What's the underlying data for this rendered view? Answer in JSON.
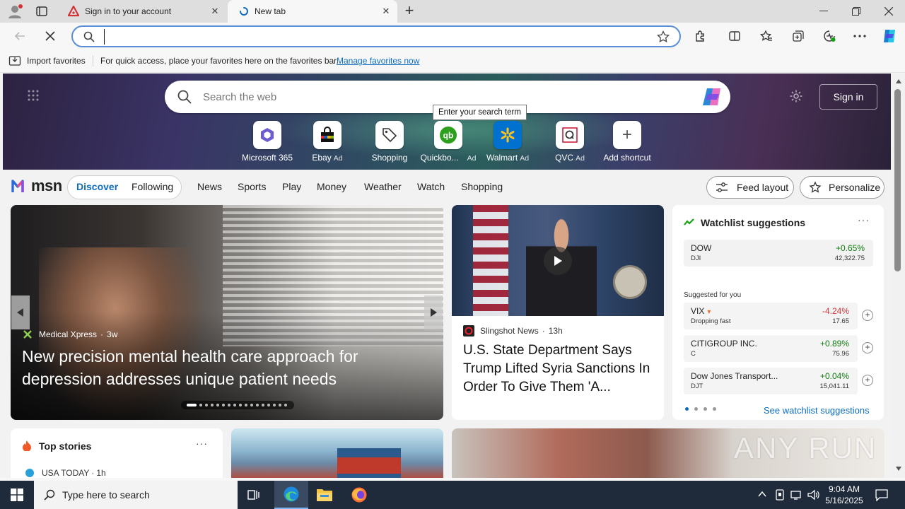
{
  "browser": {
    "tabs": [
      {
        "title": "Sign in to your account",
        "active": false
      },
      {
        "title": "New tab",
        "active": true
      }
    ],
    "address": {
      "value": "",
      "placeholder": ""
    },
    "favorites_bar": {
      "import_label": "Import favorites",
      "message": "For quick access, place your favorites here on the favorites bar.",
      "manage_link": "Manage favorites now"
    }
  },
  "newtab": {
    "search_placeholder": "Search the web",
    "tooltip": "Enter your search term",
    "sign_in": "Sign in",
    "quick_links": [
      {
        "label": "Microsoft 365",
        "ad": ""
      },
      {
        "label": "Ebay",
        "ad": "Ad"
      },
      {
        "label": "Shopping",
        "ad": ""
      },
      {
        "label": "Quickbo...",
        "ad": "Ad"
      },
      {
        "label": "Walmart",
        "ad": "Ad"
      },
      {
        "label": "QVC",
        "ad": "Ad"
      },
      {
        "label": "Add shortcut",
        "ad": ""
      }
    ]
  },
  "msn": {
    "logo": "msn",
    "tabs": [
      "Discover",
      "Following"
    ],
    "nav": [
      "News",
      "Sports",
      "Play",
      "Money",
      "Weather",
      "Watch",
      "Shopping"
    ],
    "feed_layout": "Feed layout",
    "personalize": "Personalize"
  },
  "main_story": {
    "source": "Medical Xpress",
    "age": "3w",
    "headline": "New precision mental health care approach for depression addresses unique patient needs",
    "carousel_active": 0,
    "carousel_count": 17
  },
  "video_story": {
    "source": "Slingshot News",
    "age": "13h",
    "headline": "U.S. State Department Says Trump Lifted Syria Sanctions In Order To Give Them 'A..."
  },
  "watchlist": {
    "title": "Watchlist suggestions",
    "top": {
      "name": "DOW",
      "symbol": "DJI",
      "change": "+0.65%",
      "price": "42,322.75"
    },
    "suggested_label": "Suggested for you",
    "items": [
      {
        "name": "VIX",
        "symbol": "Dropping fast",
        "change": "-4.24%",
        "price": "17.65",
        "direction": "down"
      },
      {
        "name": "CITIGROUP INC.",
        "symbol": "C",
        "change": "+0.89%",
        "price": "75.96",
        "direction": "up"
      },
      {
        "name": "Dow Jones Transport...",
        "symbol": "DJT",
        "change": "+0.04%",
        "price": "15,041.11",
        "direction": "up"
      }
    ],
    "see_more": "See watchlist suggestions"
  },
  "top_stories": {
    "title": "Top stories",
    "first_source": "USA TODAY",
    "first_age": "1h"
  },
  "watermark": "ANY RUN",
  "taskbar": {
    "search_placeholder": "Type here to search",
    "time": "9:04 AM",
    "date": "5/16/2025"
  },
  "colors": {
    "accent": "#0f6cbd",
    "positive": "#0f7b0f",
    "negative": "#d13438"
  }
}
